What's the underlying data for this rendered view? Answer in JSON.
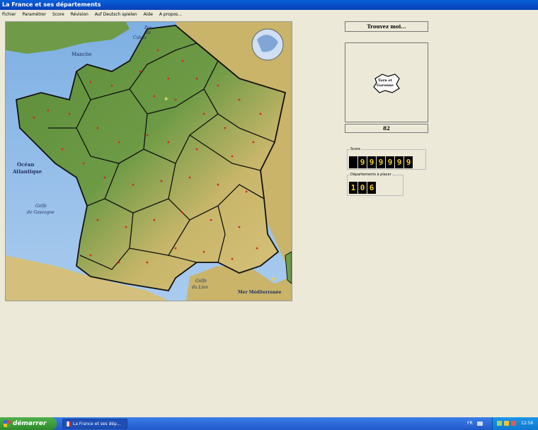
{
  "window": {
    "title": "La France et ses départements"
  },
  "menu": [
    "Fichier",
    "Paramétrer",
    "Score",
    "Révision",
    "Auf Deutsch spielen",
    "Aide",
    "A propos..."
  ],
  "map": {
    "labels": {
      "manche": "Manche",
      "pas_de_calais_1": "Pas",
      "pas_de_calais_2": "de",
      "pas_de_calais_3": "Calais",
      "ocean_1": "Océan",
      "ocean_2": "Atlantique",
      "golfe_gascogne_1": "Golfe",
      "golfe_gascogne_2": "de Gascogne",
      "golfe_lion_1": "Golfe",
      "golfe_lion_2": "du Lion",
      "mediterranee": "Mer Méditerranée"
    }
  },
  "panel": {
    "find_label": "Trouvez moi...",
    "shape_label_1": "Tarn et",
    "shape_label_2": "Garonne",
    "department_code": "82",
    "score_legend": "Score",
    "score_digits": [
      "",
      "9",
      "9",
      "9",
      "9",
      "9",
      "9"
    ],
    "remaining_legend": "Départements à placer",
    "remaining_digits": [
      "1",
      "0",
      "6"
    ]
  },
  "taskbar": {
    "start_label": "démarrer",
    "task_label": "La France et ses dép...",
    "language": "FR",
    "clock": "12:56"
  },
  "colors": {
    "sea": "#8fb8e4",
    "land_green": "#5e8f3e",
    "land_ochre": "#d9c57c",
    "digit_fg": "#f5d21a",
    "title_blue": "#0a5fd8"
  }
}
